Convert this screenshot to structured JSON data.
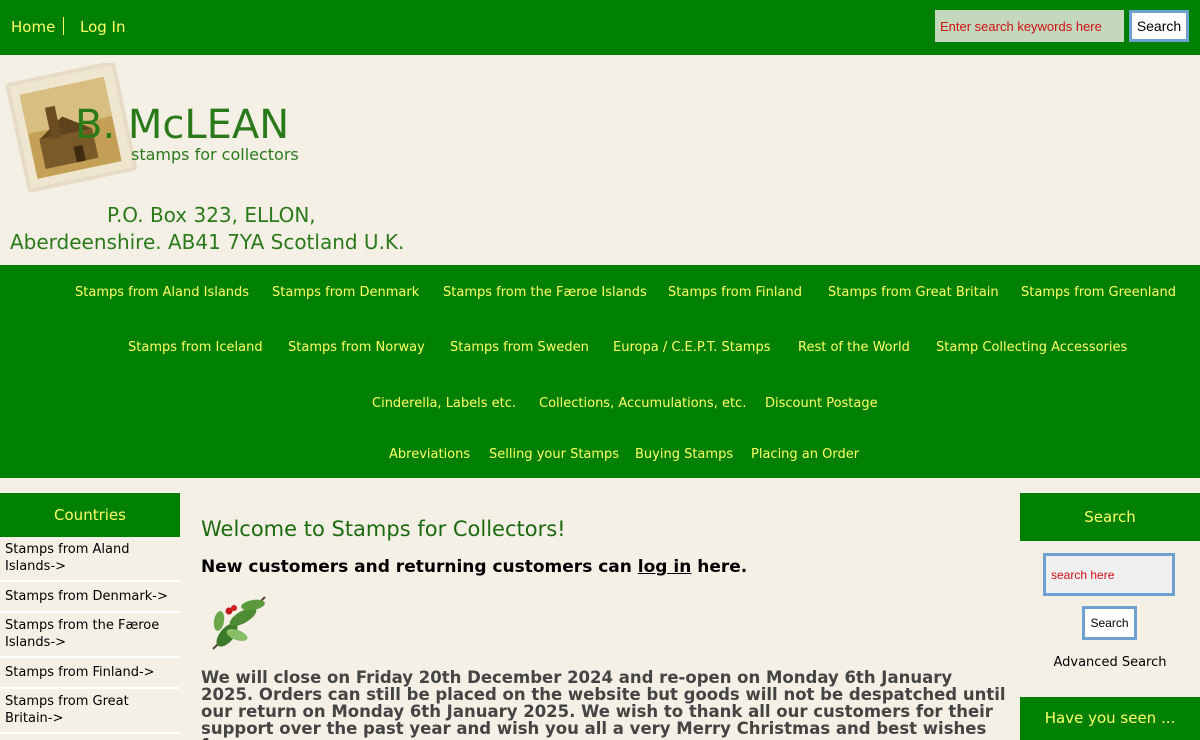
{
  "topnav": {
    "home": "Home",
    "login": "Log In",
    "search_placeholder": "Enter search keywords here",
    "search_button": "Search"
  },
  "header": {
    "logo_text": "B. McLEAN",
    "logo_tagline": "stamps for collectors",
    "address_line1": "P.O. Box 323, ELLON,",
    "address_line2": "Aberdeenshire. AB41 7YA Scotland U.K."
  },
  "catnav": [
    [
      "Stamps from Aland Islands",
      "Stamps from Denmark",
      "Stamps from the Færoe Islands",
      "Stamps from Finland",
      "Stamps from Great Britain",
      "Stamps from Greenland"
    ],
    [
      "Stamps from Iceland",
      "Stamps from Norway",
      "Stamps from Sweden",
      "Europa / C.E.P.T. Stamps",
      "Rest of the World",
      "Stamp Collecting Accessories"
    ],
    [
      "Cinderella, Labels etc.",
      "Collections, Accumulations, etc.",
      "Discount Postage"
    ],
    [
      "Abreviations",
      "Selling your Stamps",
      "Buying Stamps",
      "Placing an Order"
    ]
  ],
  "left": {
    "heading": "Countries",
    "items": [
      "Stamps from Aland Islands->",
      "Stamps from Denmark->",
      "Stamps from the Færoe Islands->",
      "Stamps from Finland->",
      "Stamps from Great Britain->"
    ]
  },
  "main": {
    "welcome": "Welcome to Stamps for Collectors!",
    "newcust_before": "New customers and returning customers can ",
    "newcust_link": "log in",
    "newcust_after": " here.",
    "notice": "We will close on Friday 20th December 2024 and re-open on Monday 6th January 2025. Orders can still be placed on the website but goods will not be despatched until our return on Monday 6th January 2025. We wish to thank all our customers for their support over the past year and wish you all a very Merry Christmas and best wishes for"
  },
  "right": {
    "heading": "Search",
    "search_placeholder": "search here",
    "search_button": "Search",
    "advanced": "Advanced Search",
    "have_seen": "Have you seen ..."
  },
  "colors": {
    "brand_green": "#008000",
    "nav_text": "#ffff66",
    "background": "#f4f0e6",
    "heading_green": "#1a6b10"
  }
}
